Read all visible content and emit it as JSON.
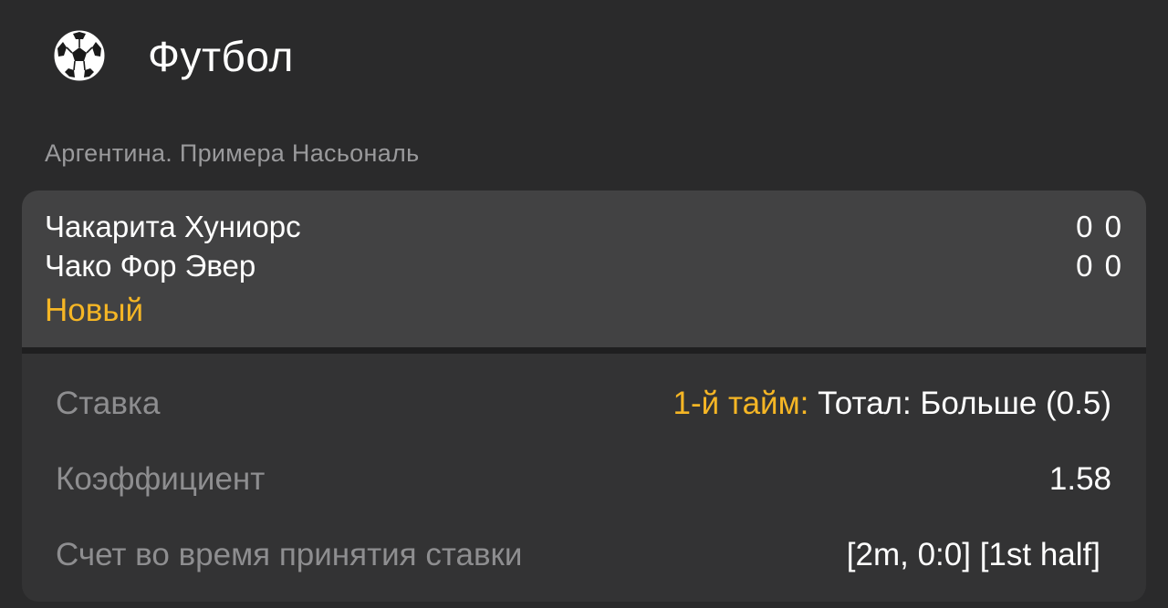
{
  "header": {
    "sport_icon": "soccer-ball-icon",
    "title": "Футбол"
  },
  "league": "Аргентина. Примера Насьональ",
  "match": {
    "teams": [
      {
        "name": "Чакарита Хуниорс",
        "score": "0  0"
      },
      {
        "name": "Чако Фор Эвер",
        "score": "0  0"
      }
    ],
    "status": "Новый"
  },
  "bet": {
    "rows": [
      {
        "label": "Ставка",
        "value_prefix": "1-й тайм:",
        "value": " Тотал: Больше (0.5)"
      },
      {
        "label": "Коэффициент",
        "value": "1.58"
      },
      {
        "label": "Счет во время принятия ставки",
        "value": "[2m, 0:0] [1st half]"
      }
    ]
  },
  "colors": {
    "background": "#2a2a2b",
    "match_card": "#424243",
    "bet_card": "#333334",
    "accent": "#f5b625",
    "muted_text": "#8e8e90"
  }
}
